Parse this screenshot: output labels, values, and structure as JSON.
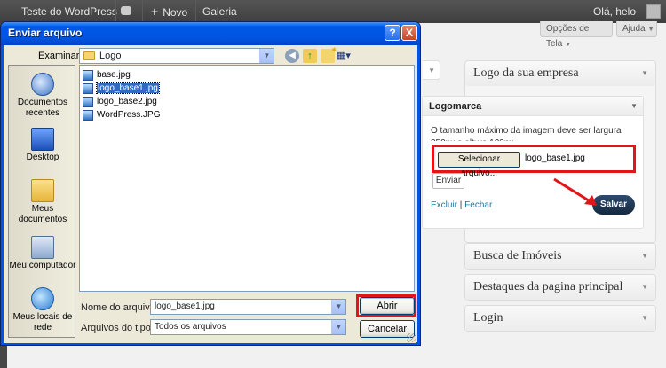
{
  "adminbar": {
    "site_name": "Teste do WordPress",
    "new_label": "Novo",
    "plus": "+",
    "gallery": "Galeria",
    "greeting": "Olá, helo"
  },
  "screen_options": {
    "screen": "Opções de Tela",
    "help": "Ajuda",
    "arrow": "▼"
  },
  "sidebar": {
    "logo_box": "Logo da sua empresa",
    "busca": "Busca de Imóveis",
    "destaques": "Destaques da pagina principal",
    "login": "Login",
    "arrow": "▼"
  },
  "widget": {
    "title": "Logomarca",
    "description": "O tamanho máximo da imagem deve ser largura 350px e altura 123px",
    "select_button": "Selecionar arquivo...",
    "selected_file": "logo_base1.jpg",
    "send_button": "Enviar",
    "delete_link": "Excluir",
    "separator": " | ",
    "close_link": "Fechar",
    "save_button": "Salvar"
  },
  "dialog": {
    "title": "Enviar arquivo",
    "help_btn": "?",
    "close_btn": "X",
    "look_in_label": "Examinar:",
    "look_in_value": "Logo",
    "combo_arrow": "▼",
    "back_icon": "◀",
    "up_icon": "↑",
    "views_icon": "▦▾",
    "places": [
      {
        "label": "Documentos recentes"
      },
      {
        "label": "Desktop"
      },
      {
        "label": "Meus documentos"
      },
      {
        "label": "Meu computador"
      },
      {
        "label": "Meus locais de rede"
      }
    ],
    "files": [
      {
        "name": "base.jpg",
        "selected": false
      },
      {
        "name": "logo_base1.jpg",
        "selected": true
      },
      {
        "name": "logo_base2.jpg",
        "selected": false
      },
      {
        "name": "WordPress.JPG",
        "selected": false
      }
    ],
    "file_name_label": "Nome do arquivo:",
    "file_name_value": "logo_base1.jpg",
    "file_type_label": "Arquivos do tipo:",
    "file_type_value": "Todos os arquivos",
    "open_button": "Abrir",
    "cancel_button": "Cancelar"
  },
  "colors": {
    "highlight_red": "#e0161b",
    "xp_blue": "#0054e3",
    "save_button": "#1e3a5a",
    "selection": "#316ac5"
  }
}
